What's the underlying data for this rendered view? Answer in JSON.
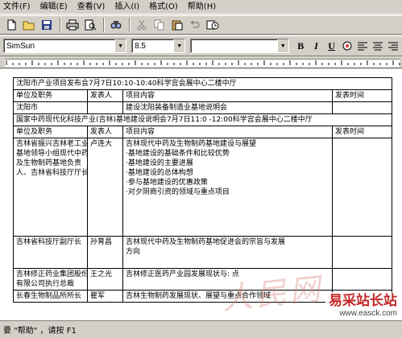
{
  "menu": {
    "items": [
      "文件(F)",
      "编辑(E)",
      "查看(V)",
      "插入(I)",
      "格式(O)",
      "帮助(H)"
    ]
  },
  "format": {
    "font_name": "SimSun",
    "font_size": "8.5",
    "style_value": ""
  },
  "table": {
    "rows": [
      {
        "type": "span",
        "text": "沈阳市产业项目发布会7月7日10:10-10:40科学宫会展中心二楼中厅"
      },
      {
        "type": "row",
        "cells": [
          "单位及职务",
          "发表人",
          "项目内容",
          "发表时间"
        ]
      },
      {
        "type": "row",
        "cells": [
          "沈阳市",
          "",
          "建设沈阳装备制造业基地说明会",
          ""
        ]
      },
      {
        "type": "span",
        "text": "国家中药现代化科技产业(吉林)基地建设说明会7月7日11:0 -12:00科学宫会展中心二楼中厅"
      },
      {
        "type": "row",
        "cells": [
          "单位及职务",
          "发表人",
          "项目内容",
          "发表时间"
        ]
      },
      {
        "type": "multi",
        "org_lines": [
          "吉林省振兴吉林老工业",
          "基地领导小组现代中药",
          "及生物制药基地负责",
          "人、吉林省科技厅厅长"
        ],
        "person": "卢连大",
        "content_lines": [
          "吉林现代中药及生物制药基地建设与展望",
          "·基地建设的基础条件和比较优势",
          "·基地建设的主要进展",
          "·基地建设的总体构想",
          "·参与基地建设的优惠政策",
          "·对夕阴商引资的领域与重点项目"
        ],
        "time": ""
      },
      {
        "type": "multi",
        "org_lines": [
          "吉林省科技厅副厅长"
        ],
        "person": "孙育昌",
        "content_lines": [
          "吉林现代中药及生物制药基地促进会的宗旨与发展",
          "方向"
        ],
        "time": ""
      },
      {
        "type": "multi",
        "org_lines": [
          "吉林修正药业集团股份",
          "有限公司执行总裁"
        ],
        "person": "王之光",
        "content_lines": [
          "吉林修正医药产业园发展现状与: 点"
        ],
        "time": ""
      },
      {
        "type": "multi",
        "org_lines": [
          "长春生物制品所所长"
        ],
        "person": "瞿军",
        "content_lines": [
          "吉林生物制药发展现状、展望与重点合作领域"
        ],
        "time": ""
      }
    ]
  },
  "watermark": {
    "site_name": "易采站长站",
    "site_url": "www.easck.com"
  },
  "status": {
    "text": "要 \"帮助\" ，请按 F1"
  },
  "icons": [
    "new-icon",
    "open-icon",
    "save-icon",
    "print-icon",
    "print-preview-icon",
    "find-icon",
    "cut-icon",
    "copy-icon",
    "paste-icon",
    "undo-icon",
    "insert-datetime-icon",
    "bold-icon",
    "italic-icon",
    "underline-icon",
    "color-icon",
    "bullets-icon",
    "align-left-icon",
    "align-center-icon",
    "align-right-icon"
  ]
}
